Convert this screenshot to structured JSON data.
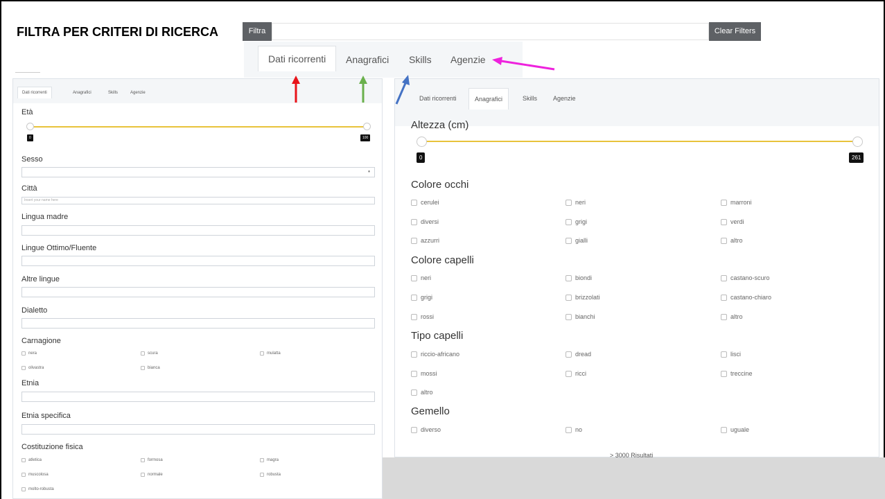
{
  "slide": {
    "title": "FILTRA PER CRITERI DI RICERCA"
  },
  "toolbar": {
    "filter_label": "Filtra",
    "clear_label": "Clear Filters"
  },
  "top_tabs": [
    "Dati ricorrenti",
    "Anagrafici",
    "Skills",
    "Agenzie"
  ],
  "left_panel": {
    "tabs": [
      "Dati ricorrenti",
      "Anagrafici",
      "Skills",
      "Agenzie"
    ],
    "active_tab": "Dati ricorrenti",
    "eta": {
      "label": "Età",
      "min": "0",
      "max": "100"
    },
    "sesso": {
      "label": "Sesso",
      "caret": "♦"
    },
    "citta": {
      "label": "Città",
      "placeholder": "Insert your name here"
    },
    "lingua_madre": "Lingua madre",
    "lingue_ottimo": "Lingue Ottimo/Fluente",
    "altre_lingue": "Altre lingue",
    "dialetto": "Dialetto",
    "carnagione": {
      "label": "Carnagione",
      "options": [
        "nera",
        "scura",
        "mulatta",
        "olivastra",
        "bianca"
      ]
    },
    "etnia": "Etnia",
    "etnia_specifica": "Etnia specifica",
    "costituzione": {
      "label": "Costituzione fisica",
      "options": [
        "atletica",
        "formosa",
        "magra",
        "muscolosa",
        "normale",
        "robusta",
        "molto-robusta"
      ]
    }
  },
  "right_panel": {
    "tabs": [
      "Dati ricorrenti",
      "Anagrafici",
      "Skills",
      "Agenzie"
    ],
    "active_tab": "Anagrafici",
    "altezza": {
      "label": "Altezza (cm)",
      "min": "0",
      "max": "261"
    },
    "colore_occhi": {
      "label": "Colore occhi",
      "options": [
        "cerulei",
        "neri",
        "marroni",
        "diversi",
        "grigi",
        "verdi",
        "azzurri",
        "gialli",
        "altro"
      ]
    },
    "colore_capelli": {
      "label": "Colore capelli",
      "options": [
        "neri",
        "biondi",
        "castano-scuro",
        "grigi",
        "brizzolati",
        "castano-chiaro",
        "rossi",
        "bianchi",
        "altro"
      ]
    },
    "tipo_capelli": {
      "label": "Tipo capelli",
      "options": [
        "riccio-africano",
        "dread",
        "lisci",
        "mossi",
        "ricci",
        "treccine",
        "altro"
      ]
    },
    "gemello": {
      "label": "Gemello",
      "options": [
        "diverso",
        "no",
        "uguale"
      ]
    }
  },
  "results_text": "> 3000 Risultati",
  "colors": {
    "arrow_red": "#e8141a",
    "arrow_green": "#6ab04c",
    "arrow_blue": "#4472c4",
    "arrow_magenta": "#ee22dd",
    "slider_track": "#e8c33a",
    "button_bg": "#5e6165"
  }
}
